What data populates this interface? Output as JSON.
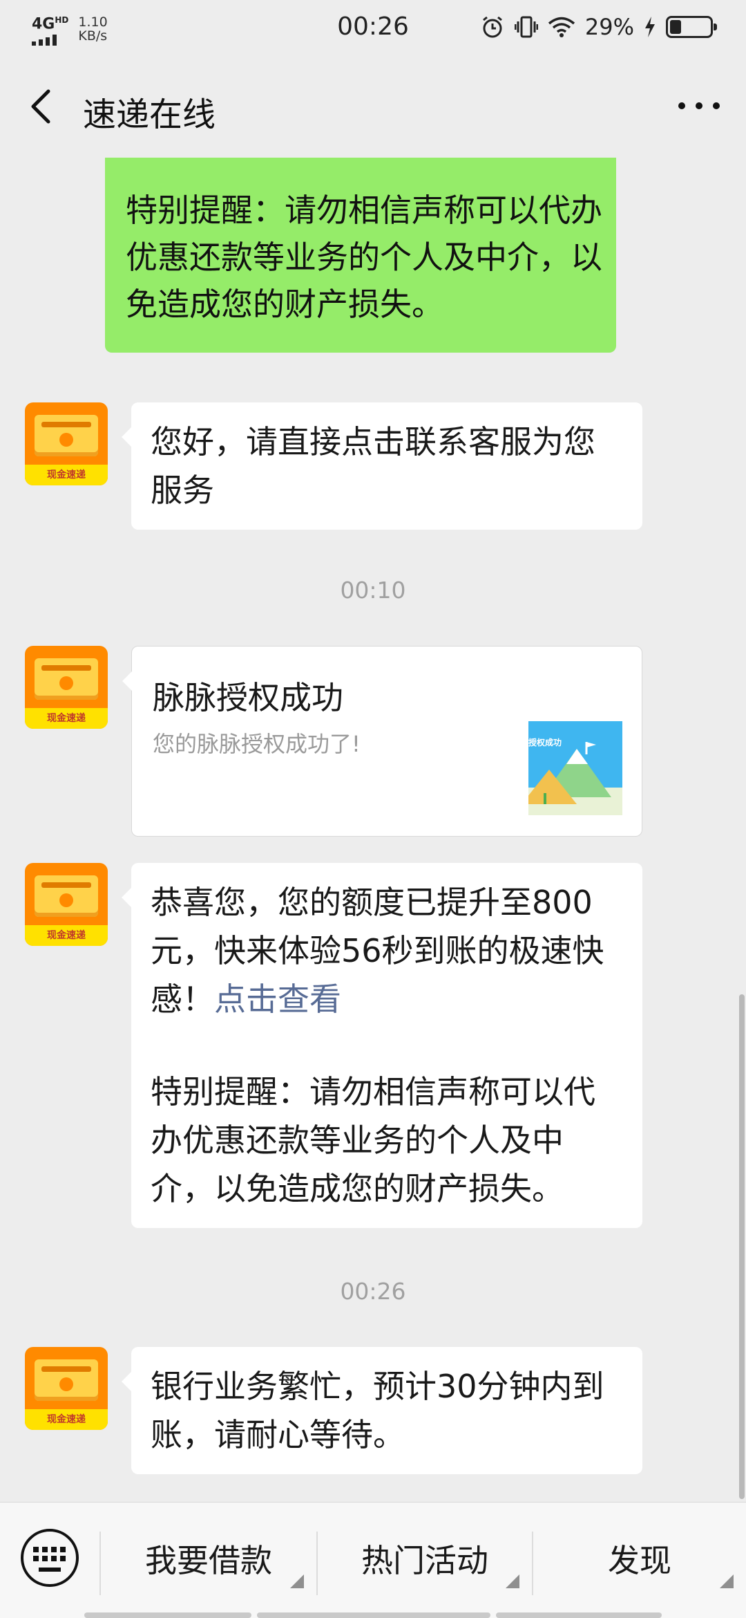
{
  "status_bar": {
    "network": "4G",
    "network_sup": "HD",
    "speed_value": "1.10",
    "speed_unit": "KB/s",
    "time": "00:26",
    "battery_percent": "29%",
    "battery_level": 0.29
  },
  "header": {
    "title": "速递在线"
  },
  "messages": {
    "m0": {
      "text": "特别提醒：请勿相信声称可以代办优惠还款等业务的个人及中介，以免造成您的财产损失。"
    },
    "m1": {
      "text": "您好，请直接点击联系客服为您服务"
    },
    "t1": "00:10",
    "m2": {
      "title": "脉脉授权成功",
      "desc": "您的脉脉授权成功了!",
      "thumb_text": "授权成功"
    },
    "m3": {
      "text": "恭喜您，您的额度已提升至800元，快来体验56秒到账的极速快感！",
      "link": "点击查看",
      "text2": "特别提醒：请勿相信声称可以代办优惠还款等业务的个人及中介，以免造成您的财产损失。"
    },
    "t2": "00:26",
    "m4": {
      "text": "银行业务繁忙，预计30分钟内到账，请耐心等待。"
    }
  },
  "avatar_label": "现金速递",
  "bottom_menu": {
    "item1": "我要借款",
    "item2": "热门活动",
    "item3": "发现"
  },
  "colors": {
    "outgoing_bubble": "#95ec69",
    "link": "#576b95",
    "background": "#ededed"
  }
}
